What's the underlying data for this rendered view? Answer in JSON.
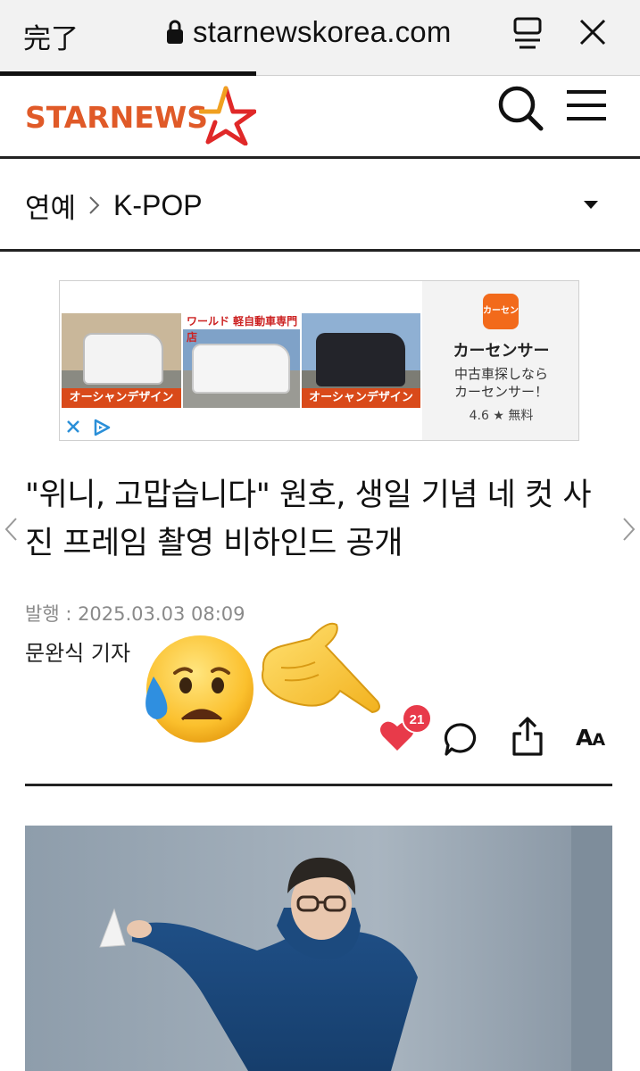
{
  "browser": {
    "done_label": "完了",
    "url": "starnewskorea.com",
    "page_load_progress": 0.4
  },
  "site": {
    "logo_text": "STARNEWS",
    "logo_color": "#e05a28"
  },
  "breadcrumb": {
    "section": "연예",
    "subsection": "K-POP"
  },
  "ad": {
    "photo_banner_1": "オーシャンデザイン",
    "photo_label_2": "ワールド 軽自動車専門店",
    "photo_banner_3": "オーシャンデザイン",
    "app_icon_text": "カーセンサー",
    "app_name": "カーセンサー",
    "description_line1": "中古車探しなら",
    "description_line2": "カーセンサー！",
    "rating": "4.6 ★ 無料"
  },
  "article": {
    "title": "\"위니, 고맙습니다\" 원호, 생일 기념 네 컷 사진 프레임 촬영 비하인드 공개",
    "published": "발행 : 2025.03.03 08:09",
    "reporter": "문완식 기자"
  },
  "actions": {
    "like_count": "21",
    "font_size_big": "A",
    "font_size_small": "A",
    "like_color": "#e83a4a"
  },
  "icons": [
    "lock-icon",
    "reader-icon",
    "close-icon",
    "search-icon",
    "menu-icon",
    "chevron-right-icon",
    "dropdown-icon",
    "heart-icon",
    "comment-icon",
    "share-icon"
  ]
}
